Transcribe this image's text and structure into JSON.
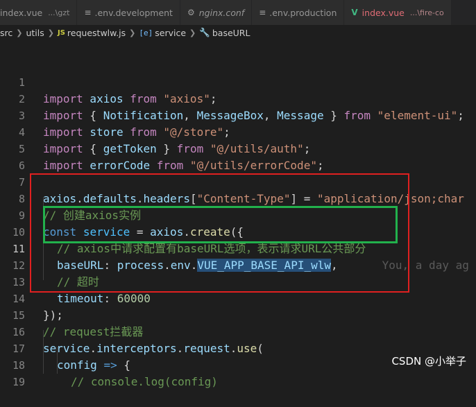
{
  "tabs": [
    {
      "label": "index.vue",
      "hint": "...\\gzt",
      "icon": "lines-icon"
    },
    {
      "label": ".env.development",
      "hint": "",
      "icon": "lines-icon"
    },
    {
      "label": "nginx.conf",
      "hint": "",
      "icon": "gear-icon"
    },
    {
      "label": ".env.production",
      "hint": "",
      "icon": "lines-icon"
    },
    {
      "label": "index.vue",
      "hint": "...\\fire-co",
      "icon": "vue-icon"
    }
  ],
  "breadcrumb": {
    "items": [
      "src",
      "utils",
      "requestwlw.js",
      "service",
      "baseURL"
    ],
    "js_badge": "JS"
  },
  "code": {
    "line_numbers": [
      "1",
      "2",
      "3",
      "4",
      "5",
      "6",
      "7",
      "8",
      "9",
      "10",
      "11",
      "12",
      "13",
      "14",
      "15",
      "16",
      "17",
      "18",
      "19"
    ],
    "l1": {
      "a": "import",
      "b": " axios ",
      "c": "from",
      "d": " \"axios\"",
      "e": ";"
    },
    "l2": {
      "a": "import",
      "b": " { ",
      "c": "Notification",
      "d": ", ",
      "e": "MessageBox",
      "f": ", ",
      "g": "Message",
      "h": " } ",
      "i": "from",
      "j": " \"element-ui\"",
      "k": ";"
    },
    "l3": {
      "a": "import",
      "b": " store ",
      "c": "from",
      "d": " \"@/store\"",
      "e": ";"
    },
    "l4": {
      "a": "import",
      "b": " { ",
      "c": "getToken",
      "d": " } ",
      "e": "from",
      "f": " \"@/utils/auth\"",
      "g": ";"
    },
    "l5": {
      "a": "import",
      "b": " errorCode ",
      "c": "from",
      "d": " \"@/utils/errorCode\"",
      "e": ";"
    },
    "l7": {
      "a": "axios",
      "b": ".",
      "c": "defaults",
      "d": ".",
      "e": "headers",
      "f": "[",
      "g": "\"Content-Type\"",
      "h": "] = ",
      "i": "\"application/json;char"
    },
    "l8": "// 创建axios实例",
    "l9": {
      "a": "const",
      "b": " ",
      "c": "service",
      "d": " = ",
      "e": "axios",
      "f": ".",
      "g": "create",
      "h": "({"
    },
    "l10": "// axios中请求配置有baseURL选项，表示请求URL公共部分",
    "l11": {
      "a": "baseURL",
      "b": ": ",
      "c": "process",
      "d": ".",
      "e": "env",
      "f": ".",
      "g": "VUE_APP_BASE_API_wlw",
      "h": ",",
      "ghost": "You, a day ag"
    },
    "l12": "// 超时",
    "l13": {
      "a": "timeout",
      "b": ": ",
      "c": "60000"
    },
    "l14": "});",
    "l15": "// request拦截器",
    "l16": {
      "a": "service",
      "b": ".",
      "c": "interceptors",
      "d": ".",
      "e": "request",
      "f": ".",
      "g": "use",
      "h": "("
    },
    "l17": {
      "a": "config",
      "b": " ",
      "c": "=>",
      "d": " {"
    },
    "l18": "// console.log(config)"
  },
  "watermark": "CSDN @小举子",
  "colors": {
    "keyword": "#c586c0",
    "string": "#ce9178",
    "variable": "#9cdcfe",
    "function": "#dcdcaa",
    "number": "#b5cea8",
    "comment": "#6a9955",
    "storage": "#569cd6",
    "highlight_red": "#e02020",
    "highlight_green": "#22b14c"
  }
}
